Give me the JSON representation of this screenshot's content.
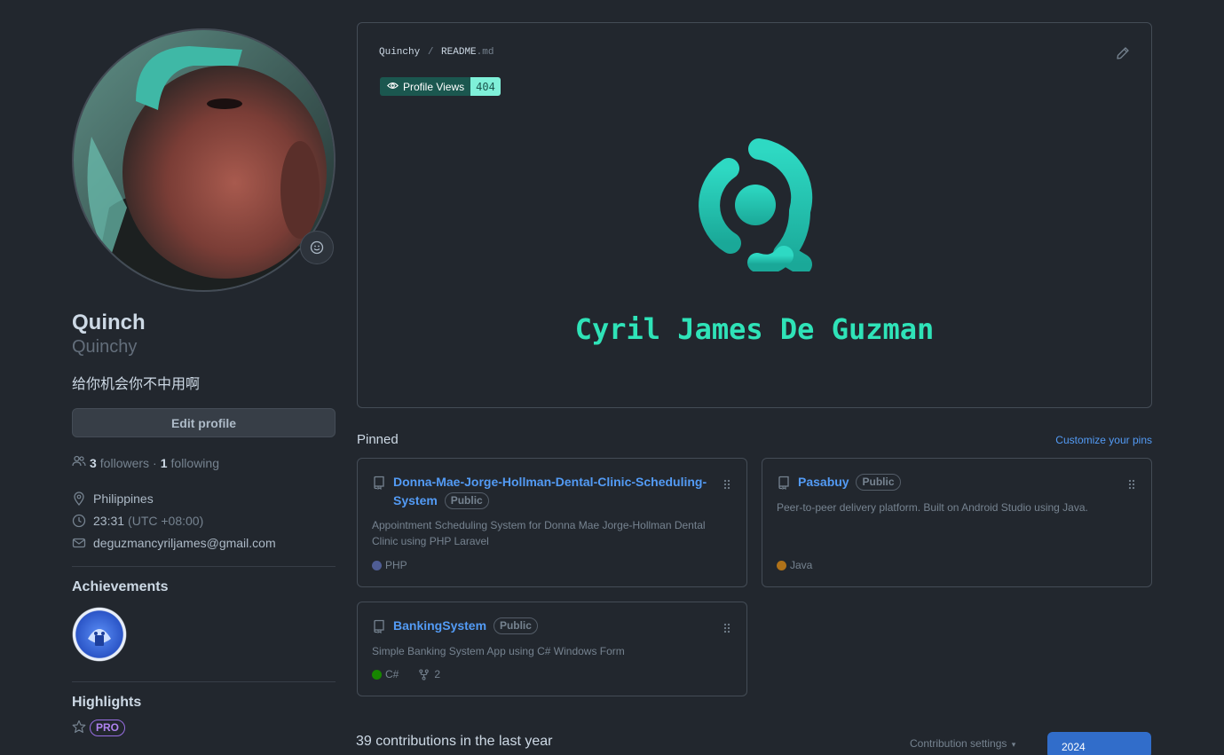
{
  "profile": {
    "display_name": "Quinch",
    "login": "Quinchy",
    "bio": "给你机会你不中用啊",
    "edit_label": "Edit profile",
    "followers_count": "3",
    "followers_label": "followers",
    "separator": "·",
    "following_count": "1",
    "following_label": "following",
    "location": "Philippines",
    "local_time": "23:31",
    "timezone": "(UTC +08:00)",
    "email": "deguzmancyriljames@gmail.com",
    "avatar_icon": "capybara-avatar",
    "status_icon": "smiley-icon"
  },
  "achievements": {
    "title": "Achievements",
    "badge_icon": "shark-achievement-badge"
  },
  "highlights": {
    "title": "Highlights",
    "pro_label": "PRO",
    "icon": "star-icon"
  },
  "readme": {
    "owner": "Quinchy",
    "separator": "/",
    "file": "README",
    "ext": ".md",
    "views_label": "Profile Views",
    "views_count": "404",
    "banner_name": "Cyril James De Guzman",
    "accent": "#2fe3b8"
  },
  "pinned": {
    "title": "Pinned",
    "customize_label": "Customize your pins",
    "repos": [
      {
        "name": "Donna-Mae-Jorge-Hollman-Dental-Clinic-Scheduling-System",
        "visibility": "Public",
        "description": "Appointment Scheduling System for Donna Mae Jorge-Hollman Dental Clinic using PHP Laravel",
        "language": "PHP",
        "language_color": "#4F5D95"
      },
      {
        "name": "Pasabuy",
        "visibility": "Public",
        "description": "Peer-to-peer delivery platform. Built on Android Studio using Java.",
        "language": "Java",
        "language_color": "#b07219"
      },
      {
        "name": "BankingSystem",
        "visibility": "Public",
        "description": "Simple Banking System App using C# Windows Form",
        "language": "C#",
        "language_color": "#178600",
        "forks": "2"
      }
    ]
  },
  "contributions": {
    "heading": "39 contributions in the last year",
    "settings_label": "Contribution settings",
    "year": "2024"
  }
}
